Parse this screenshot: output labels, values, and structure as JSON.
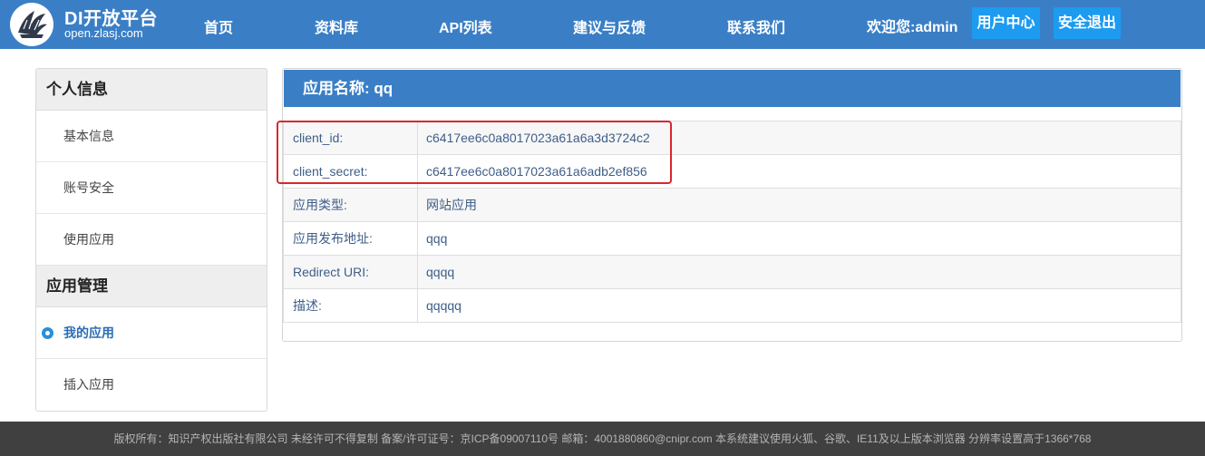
{
  "header": {
    "brand_title": "DI开放平台",
    "brand_subtitle": "open.zlasj.com",
    "nav": [
      "首页",
      "资料库",
      "API列表",
      "建议与反馈",
      "联系我们"
    ],
    "welcome": "欢迎您:admin",
    "user_center": "用户中心",
    "logout": "安全退出",
    "logo_icon": "crown-quill-logo"
  },
  "sidebar": {
    "sections": [
      {
        "title": "个人信息",
        "items": [
          "基本信息",
          "账号安全",
          "使用应用"
        ]
      },
      {
        "title": "应用管理",
        "items": [
          "我的应用",
          "插入应用"
        ]
      }
    ],
    "active_item": "我的应用"
  },
  "panel": {
    "title": "应用名称: qq",
    "rows": [
      {
        "label": "client_id:",
        "value": "c6417ee6c0a8017023a61a6a3d3724c2"
      },
      {
        "label": "client_secret:",
        "value": "c6417ee6c0a8017023a61a6adb2ef856"
      },
      {
        "label": "应用类型:",
        "value": "网站应用"
      },
      {
        "label": "应用发布地址:",
        "value": "qqq"
      },
      {
        "label": "Redirect URI:",
        "value": "qqqq"
      },
      {
        "label": "描述:",
        "value": "qqqqq"
      }
    ]
  },
  "footer": {
    "text": "版权所有：知识产权出版社有限公司    未经许可不得复制  备案/许可证号：京ICP备09007110号  邮箱：4001880860@cnipr.com  本系统建议使用火狐、谷歌、IE11及以上版本浏览器 分辨率设置高于1366*768"
  },
  "colors": {
    "header_bg": "#3a7fc6",
    "button_bg": "#1d9bf0",
    "highlight": "#d9272e",
    "footer_bg": "#404040"
  }
}
